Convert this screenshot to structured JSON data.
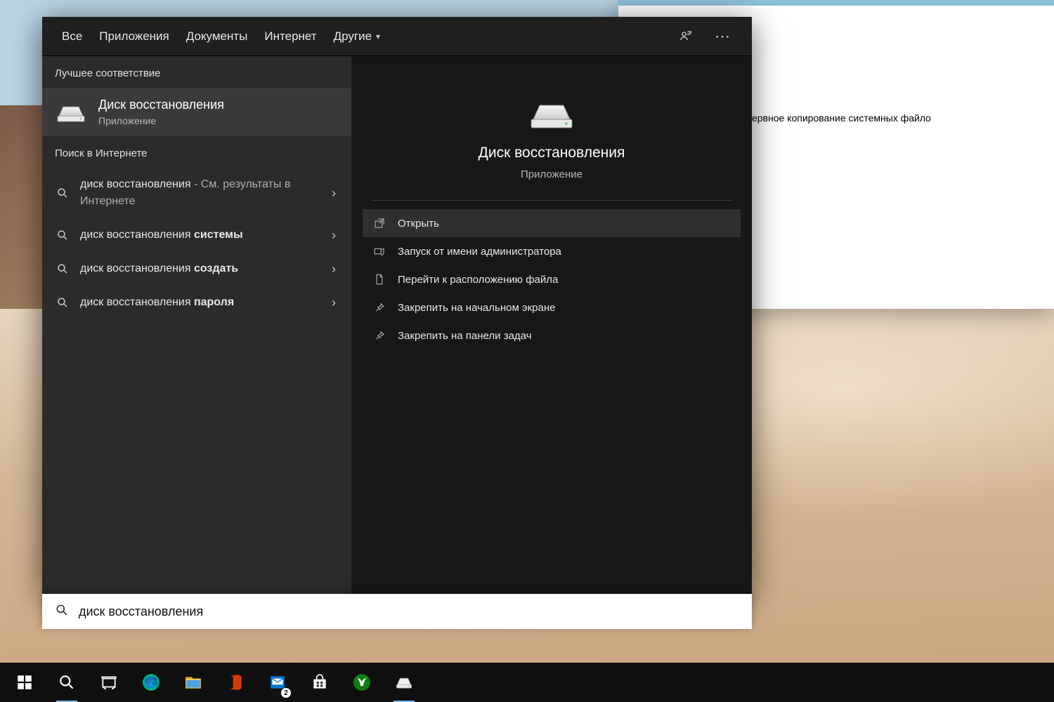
{
  "bg_window": {
    "partial_text": "ервное копирование системных файло"
  },
  "tabs": {
    "items": [
      {
        "label": "Все"
      },
      {
        "label": "Приложения"
      },
      {
        "label": "Документы"
      },
      {
        "label": "Интернет"
      },
      {
        "label": "Другие"
      }
    ]
  },
  "left": {
    "best_match_label": "Лучшее соответствие",
    "best_match": {
      "title": "Диск восстановления",
      "subtitle": "Приложение"
    },
    "web_label": "Поиск в Интернете",
    "web_items": [
      {
        "prefix": "диск восстановления",
        "bold": "",
        "suffix": " - См. результаты в Интернете"
      },
      {
        "prefix": "диск восстановления ",
        "bold": "системы",
        "suffix": ""
      },
      {
        "prefix": "диск восстановления ",
        "bold": "создать",
        "suffix": ""
      },
      {
        "prefix": "диск восстановления ",
        "bold": "пароля",
        "suffix": ""
      }
    ]
  },
  "right": {
    "title": "Диск восстановления",
    "subtitle": "Приложение",
    "actions": [
      {
        "label": "Открыть",
        "icon": "open-icon"
      },
      {
        "label": "Запуск от имени администратора",
        "icon": "shield-icon"
      },
      {
        "label": "Перейти к расположению файла",
        "icon": "folder-icon"
      },
      {
        "label": "Закрепить на начальном экране",
        "icon": "pin-icon"
      },
      {
        "label": "Закрепить на панели задач",
        "icon": "pin-icon"
      }
    ]
  },
  "search": {
    "value": "диск восстановления"
  },
  "taskbar": {
    "badge": "2"
  }
}
